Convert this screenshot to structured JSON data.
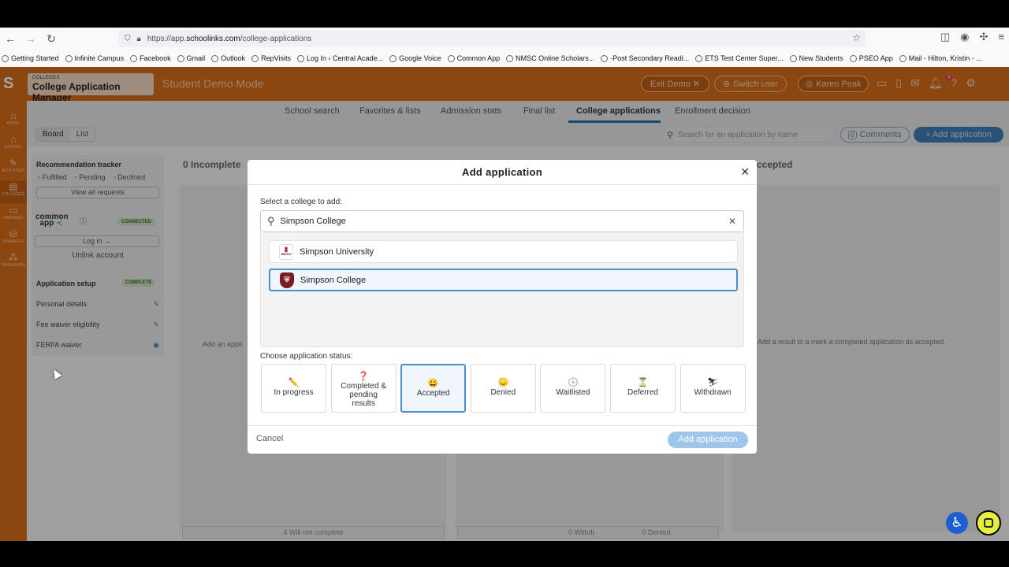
{
  "browser": {
    "url_prefix": "https://app.",
    "url_domain": "schoolinks.com",
    "url_path": "/college-applications",
    "bookmarks": [
      "Getting Started",
      "Infinite Campus",
      "Facebook",
      "Gmail",
      "Outlook",
      "RepVisits",
      "Log In ‹ Central Acade...",
      "Google Voice",
      "Common App",
      "NMSC Online Scholars...",
      "-Post Secondary Readi...",
      "ETS Test Center Super...",
      "New Students",
      "PSEO App",
      "Mail - Hilton, Kristin - ..."
    ]
  },
  "header": {
    "app_small": "COLLEGES",
    "app_title": "College Application Manager",
    "demo_mode": "Student Demo Mode",
    "exit_demo": "Exit Demo ✕",
    "switch_user": "Switch user",
    "user_name": "Karen Peak",
    "notif_count": "6"
  },
  "leftnav": [
    "HOME",
    "SCHOOL",
    "ACTIVITIES",
    "COLLEGES",
    "CAREERS",
    "FINANCES",
    "PROGRAMS"
  ],
  "tabs": [
    "School search",
    "Favorites & lists",
    "Admission stats",
    "Final list",
    "College applications",
    "Enrollment decision"
  ],
  "toolbar": {
    "board": "Board",
    "list": "List",
    "search_placeholder": "Search for an application by name",
    "comments_count": "0",
    "comments": "Comments",
    "add_application": "+ Add application"
  },
  "sidepanel": {
    "rec_title": "Recommendation tracker",
    "fulfilled": "Fulfilled",
    "pending": "Pending",
    "declined": "Declined",
    "view_requests": "View all requests",
    "commonapp_logo": "common app",
    "connected": "CONNECTED",
    "login": "Log in →",
    "unlink": "Unlink account",
    "setup_title": "Application setup",
    "complete": "COMPLETE",
    "items": [
      "Personal details",
      "Fee waiver eligibility",
      "FERPA waiver"
    ]
  },
  "columns": {
    "incomplete_count": "0",
    "incomplete_title": "Incomplete",
    "accepted_title": "ccepted",
    "add_an": "Add an appli",
    "accepted_hint": "Add a result to a mark a completed application as accepted.",
    "foot1": "4  Will not complete",
    "foot2": "0  Withdrawn",
    "foot3": "0  Denied"
  },
  "modal": {
    "title": "Add application",
    "select_label": "Select a college to add:",
    "search_value": "Simpson College",
    "results": [
      "Simpson University",
      "Simpson College"
    ],
    "seal_text": "IMPSO",
    "status_label": "Choose application status:",
    "statuses": [
      {
        "label": "In progress",
        "icon": "pencil-icon",
        "glyph": "✏️"
      },
      {
        "label": "Completed & pending results",
        "icon": "question-icon",
        "glyph": "❓"
      },
      {
        "label": "Accepted",
        "icon": "happy-face-icon",
        "glyph": "😀"
      },
      {
        "label": "Denied",
        "icon": "sad-face-icon",
        "glyph": "😞"
      },
      {
        "label": "Waitlisted",
        "icon": "clock-icon",
        "glyph": "🕓"
      },
      {
        "label": "Deferred",
        "icon": "hourglass-icon",
        "glyph": "⏳"
      },
      {
        "label": "Withdrawn",
        "icon": "withdraw-icon",
        "glyph": "⛷"
      }
    ],
    "cancel": "Cancel",
    "add_button": "Add application"
  },
  "colors": {
    "brand_orange": "#d86c1a",
    "accent_blue": "#3f7fb6",
    "selected_border": "#4a8ecb"
  }
}
